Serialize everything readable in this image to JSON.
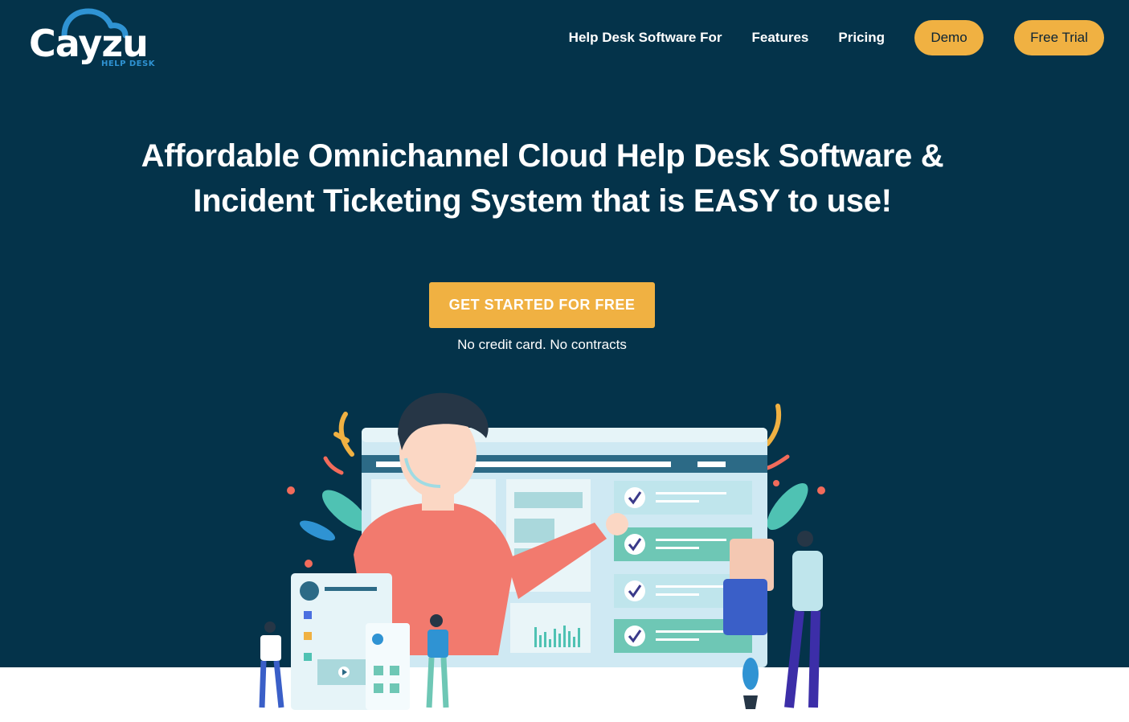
{
  "brand": {
    "name": "Cayzu",
    "subtitle": "HELP DESK",
    "colors": {
      "background": "#04334a",
      "accent": "#f0b142",
      "logo_blue": "#2f93d3"
    }
  },
  "nav": {
    "links": [
      "Help Desk Software For",
      "Features",
      "Pricing"
    ],
    "demo_label": "Demo",
    "trial_label": "Free Trial"
  },
  "hero": {
    "headline_line1": "Affordable Omnichannel Cloud Help Desk Software &",
    "headline_line2": "Incident Ticketing System that is EASY to use!",
    "cta_label": "GET STARTED FOR FREE",
    "cta_note": "No credit card. No contracts"
  },
  "illustration": {
    "name": "help-desk-agent-illustration",
    "icons": [
      "check-icon",
      "play-icon",
      "bar-chart-icon",
      "avatar-icon"
    ]
  }
}
